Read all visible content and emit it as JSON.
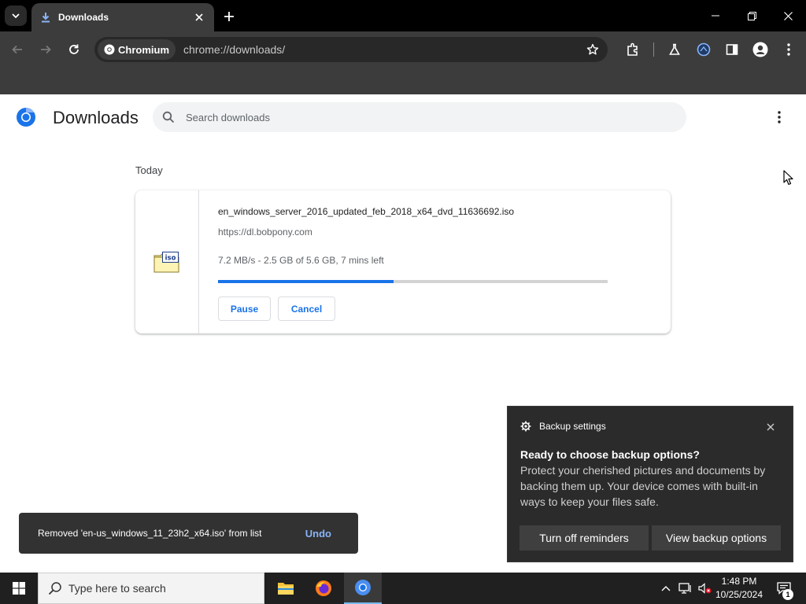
{
  "browser": {
    "tab_title": "Downloads",
    "site_chip": "Chromium",
    "url": "chrome://downloads/"
  },
  "page": {
    "title": "Downloads",
    "search_placeholder": "Search downloads",
    "section_label": "Today"
  },
  "download": {
    "file_name": "en_windows_server_2016_updated_feb_2018_x64_dvd_11636692.iso",
    "source": "https://dl.bobpony.com",
    "status": "7.2 MB/s - 2.5 GB of 5.6 GB, 7 mins left",
    "progress_fraction": 0.45,
    "icon_label": "iso",
    "pause_label": "Pause",
    "cancel_label": "Cancel"
  },
  "snackbar": {
    "message": "Removed 'en-us_windows_11_23h2_x64.iso' from list",
    "undo_label": "Undo"
  },
  "toast": {
    "app_name": "Backup settings",
    "title": "Ready to choose backup options?",
    "body": "Protect your cherished pictures and documents by backing them up. Your device comes with built-in ways to keep your files safe.",
    "btn_turn_off": "Turn off reminders",
    "btn_view": "View backup options"
  },
  "taskbar": {
    "search_placeholder": "Type here to search",
    "time": "1:48 PM",
    "date": "10/25/2024",
    "notification_count": "1"
  },
  "colors": {
    "accent": "#1a73e8",
    "progress_track": "#d3d3d3",
    "snackbar_bg": "#323232",
    "snackbar_action": "#8ab4f8",
    "toast_bg": "#2b2b2b",
    "taskbar_bg": "#202020"
  }
}
